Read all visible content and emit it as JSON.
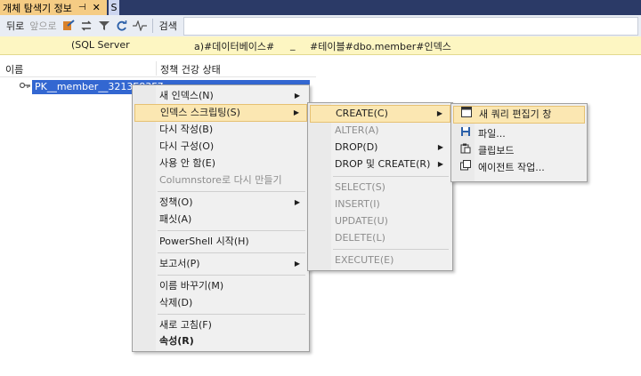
{
  "tabs": {
    "active_label": "개체 탐색기 정보",
    "pin_glyph": "⊣",
    "close_glyph": "✕",
    "second_label": "S"
  },
  "toolbar": {
    "back": "뒤로",
    "forward": "앞으로",
    "search_label": "검색",
    "search_value": ""
  },
  "path": {
    "part1": "(SQL Server",
    "part2": "a)#데이터베이스#",
    "part3": "_",
    "part4": "#테이블#dbo.member#인덱스"
  },
  "list": {
    "col_name": "이름",
    "col_health": "정책 건강 상태",
    "selected_item": "PK__member__3213E83F7"
  },
  "menu1": {
    "items": [
      {
        "label": "새 인덱스(N)",
        "submenu": true
      },
      {
        "label": "인덱스 스크립팅(S)",
        "submenu": true,
        "highlight": true
      },
      {
        "label": "다시 작성(B)"
      },
      {
        "label": "다시 구성(O)"
      },
      {
        "label": "사용 안 함(E)"
      },
      {
        "label": "Columnstore로 다시 만들기",
        "disabled": true
      },
      {
        "label": "정책(O)",
        "submenu": true
      },
      {
        "label": "패싯(A)"
      },
      {
        "label": "PowerShell 시작(H)"
      },
      {
        "label": "보고서(P)",
        "submenu": true
      },
      {
        "label": "이름 바꾸기(M)"
      },
      {
        "label": "삭제(D)"
      },
      {
        "label": "새로 고침(F)"
      },
      {
        "label": "속성(R)",
        "bold": true
      }
    ]
  },
  "menu2": {
    "items": [
      {
        "label": "CREATE(C)",
        "submenu": true,
        "highlight": true
      },
      {
        "label": "ALTER(A)",
        "disabled": true
      },
      {
        "label": "DROP(D)",
        "submenu": true
      },
      {
        "label": "DROP 및 CREATE(R)",
        "submenu": true
      },
      {
        "label": "SELECT(S)",
        "disabled": true
      },
      {
        "label": "INSERT(I)",
        "disabled": true
      },
      {
        "label": "UPDATE(U)",
        "disabled": true
      },
      {
        "label": "DELETE(L)",
        "disabled": true
      },
      {
        "label": "EXECUTE(E)",
        "disabled": true
      }
    ]
  },
  "menu3": {
    "items": [
      {
        "label": "새 쿼리 편집기 창",
        "icon": "query-window-icon",
        "highlight": true
      },
      {
        "label": "파일...",
        "icon": "file-icon"
      },
      {
        "label": "클립보드",
        "icon": "clipboard-icon"
      },
      {
        "label": "에이전트 작업...",
        "icon": "agent-job-icon"
      }
    ]
  }
}
